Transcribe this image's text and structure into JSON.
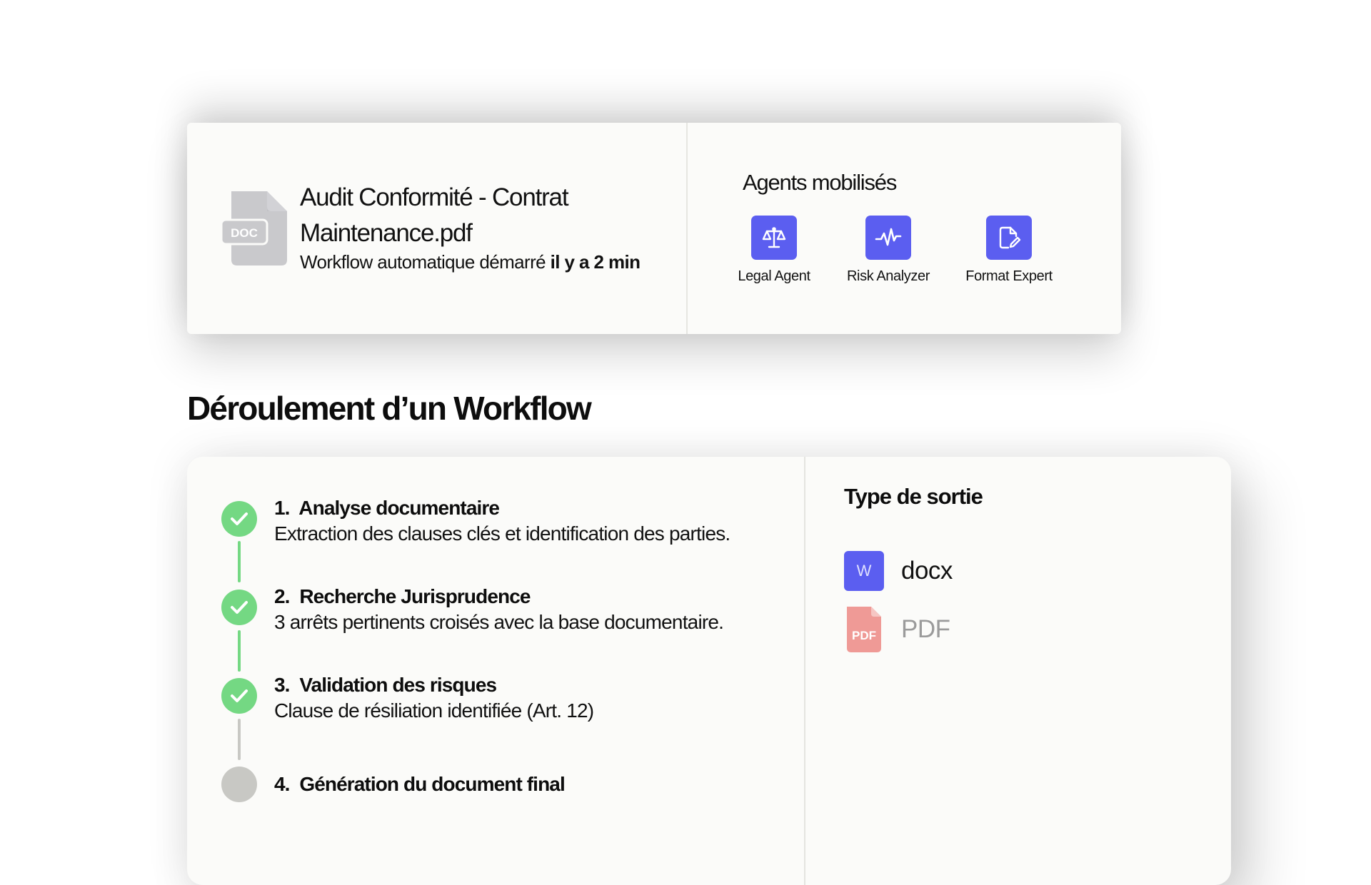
{
  "top_card": {
    "document": {
      "icon": "doc-file-icon",
      "icon_label": "DOC",
      "title": "Audit Conformité - Contrat Maintenance.pdf",
      "subtitle_prefix": "Workflow automatique démarré",
      "subtitle_time": "il y a 2 min"
    },
    "agents": {
      "title": "Agents mobilisés",
      "items": [
        {
          "icon": "scales-icon",
          "label": "Legal Agent"
        },
        {
          "icon": "pulse-icon",
          "label": "Risk Analyzer"
        },
        {
          "icon": "file-edit-icon",
          "label": "Format Expert"
        }
      ]
    }
  },
  "workflow": {
    "title": "Déroulement d’un Workflow",
    "steps": [
      {
        "number": "1.",
        "title": "Analyse documentaire",
        "description": "Extraction des clauses clés et identification des parties.",
        "status": "done"
      },
      {
        "number": "2.",
        "title": "Recherche Jurisprudence",
        "description": "3 arrêts pertinents croisés avec la base documentaire.",
        "status": "done"
      },
      {
        "number": "3.",
        "title": "Validation des risques",
        "description": "Clause de résiliation identifiée (Art. 12)",
        "status": "done"
      },
      {
        "number": "4.",
        "title": "Génération du document final",
        "description": "",
        "status": "pending"
      }
    ],
    "output": {
      "title": "Type de sortie",
      "items": [
        {
          "icon": "word-doc-icon",
          "badge": "W",
          "label": "docx",
          "active": true
        },
        {
          "icon": "pdf-file-icon",
          "badge": "PDF",
          "label": "PDF",
          "active": false
        }
      ]
    }
  },
  "colors": {
    "accent": "#5b5ef0",
    "done": "#74d883",
    "pending": "#c8c8c4",
    "pdf": "#ef9a96",
    "doc_icon": "#c9c9cc"
  }
}
